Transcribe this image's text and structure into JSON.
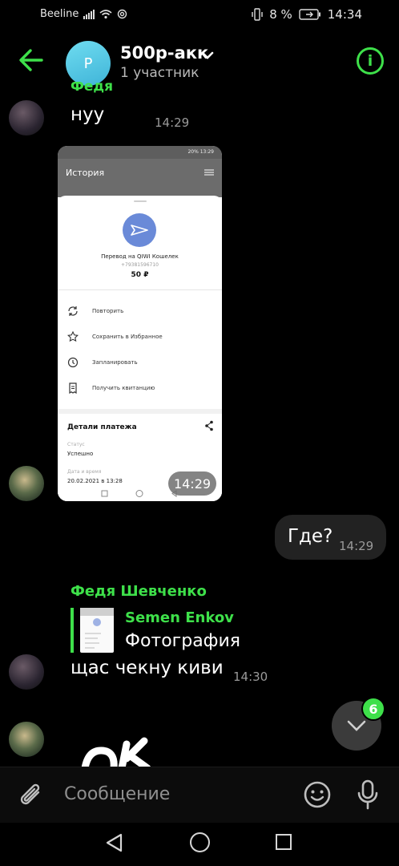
{
  "status_bar": {
    "carrier": "Beeline",
    "battery": "8 %",
    "time": "14:34"
  },
  "header": {
    "title": "500р-акк",
    "subtitle": "1 участник",
    "avatar_letter": "P"
  },
  "chat": {
    "clipped_sender": "Федя Шевченко",
    "msg1": {
      "text": "нуу",
      "time": "14:29"
    },
    "photo": {
      "time": "14:29",
      "status_left": "",
      "status_right": "20% 13:29",
      "screen_title": "История",
      "payment_title": "Перевод на QIWI Кошелек",
      "payment_phone": "+79381596710",
      "payment_amount": "50 ₽",
      "actions": [
        "Повторить",
        "Сохранить в Избранное",
        "Запланировать",
        "Получить квитанцию"
      ],
      "details_title": "Детали платежа",
      "status_label": "Статус",
      "status_value": "Успешно",
      "date_label": "Дата и время",
      "date_value": "20.02.2021 в 13:28"
    },
    "msg_out": {
      "text": "Где?",
      "time": "14:29"
    },
    "msg3": {
      "sender": "Федя Шевченко",
      "reply_name": "Semen Enkov",
      "reply_text": "Фотография",
      "text": "щас чекну киви",
      "time": "14:30"
    },
    "unread_badge": "6"
  },
  "composer": {
    "placeholder": "Сообщение"
  },
  "colors": {
    "accent": "#3ee04a",
    "background": "#000000",
    "bubble_out": "#222222"
  }
}
